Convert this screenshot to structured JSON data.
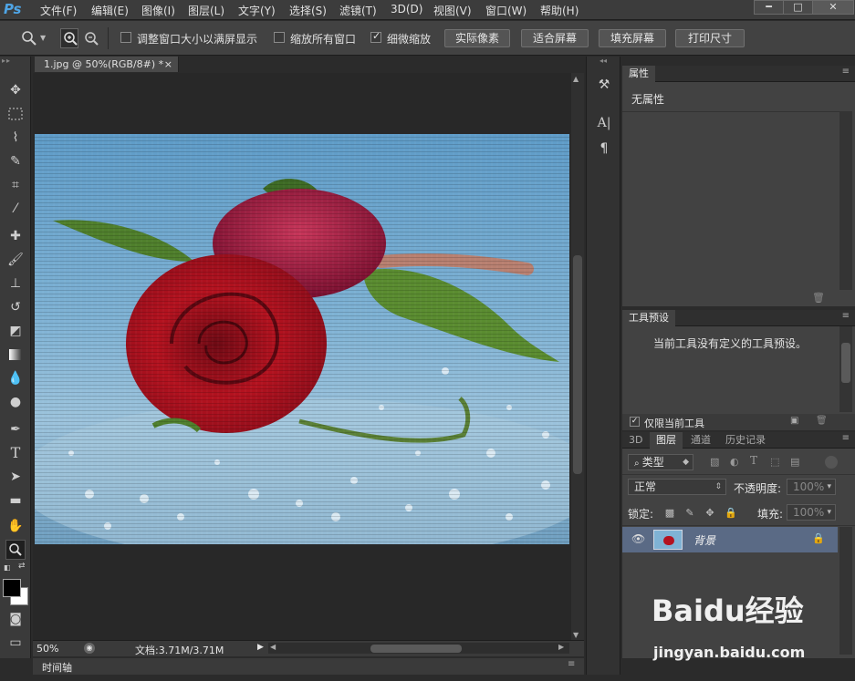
{
  "app": {
    "logo_text": "Ps"
  },
  "menu": {
    "items": [
      "文件(F)",
      "编辑(E)",
      "图像(I)",
      "图层(L)",
      "文字(Y)",
      "选择(S)",
      "滤镜(T)",
      "3D(D)",
      "视图(V)",
      "窗口(W)",
      "帮助(H)"
    ]
  },
  "window_controls": {
    "minimize": "━",
    "restore": "□",
    "close": "✕"
  },
  "options": {
    "resize_windows_label": "调整窗口大小以满屏显示",
    "resize_windows_checked": false,
    "zoom_all_label": "缩放所有窗口",
    "zoom_all_checked": false,
    "scrubby_zoom_label": "细微缩放",
    "scrubby_zoom_checked": true,
    "btn_actual_pixels": "实际像素",
    "btn_fit_screen": "适合屏幕",
    "btn_fill_screen": "填充屏幕",
    "btn_print_size": "打印尺寸"
  },
  "document": {
    "tab_title": "1.jpg @ 50%(RGB/8#) *",
    "tab_close": "×"
  },
  "status": {
    "zoom": "50%",
    "doc_info": "文档:3.71M/3.71M",
    "arrow": "▶"
  },
  "timeline": {
    "label": "时间轴"
  },
  "properties": {
    "tab": "属性",
    "body": "无属性"
  },
  "tool_presets": {
    "tab": "工具预设",
    "empty_text": "当前工具没有定义的工具预设。",
    "current_only_label": "仅限当前工具",
    "current_only_checked": true
  },
  "layers": {
    "tabs": [
      "3D",
      "图层",
      "通道",
      "历史记录"
    ],
    "active_tab": "图层",
    "filter_kind": "类型",
    "blend_mode": "正常",
    "opacity_label": "不透明度:",
    "opacity_value": "100%",
    "lock_label": "锁定:",
    "fill_label": "填充:",
    "fill_value": "100%",
    "items": [
      {
        "name": "背景",
        "locked": true,
        "visible": true
      }
    ]
  },
  "watermark": {
    "text": "Baidu经验",
    "sub": "jingyan.baidu.com"
  },
  "colors": {
    "accent": "#4fa5e6",
    "selected_layer": "#5a6a85"
  }
}
